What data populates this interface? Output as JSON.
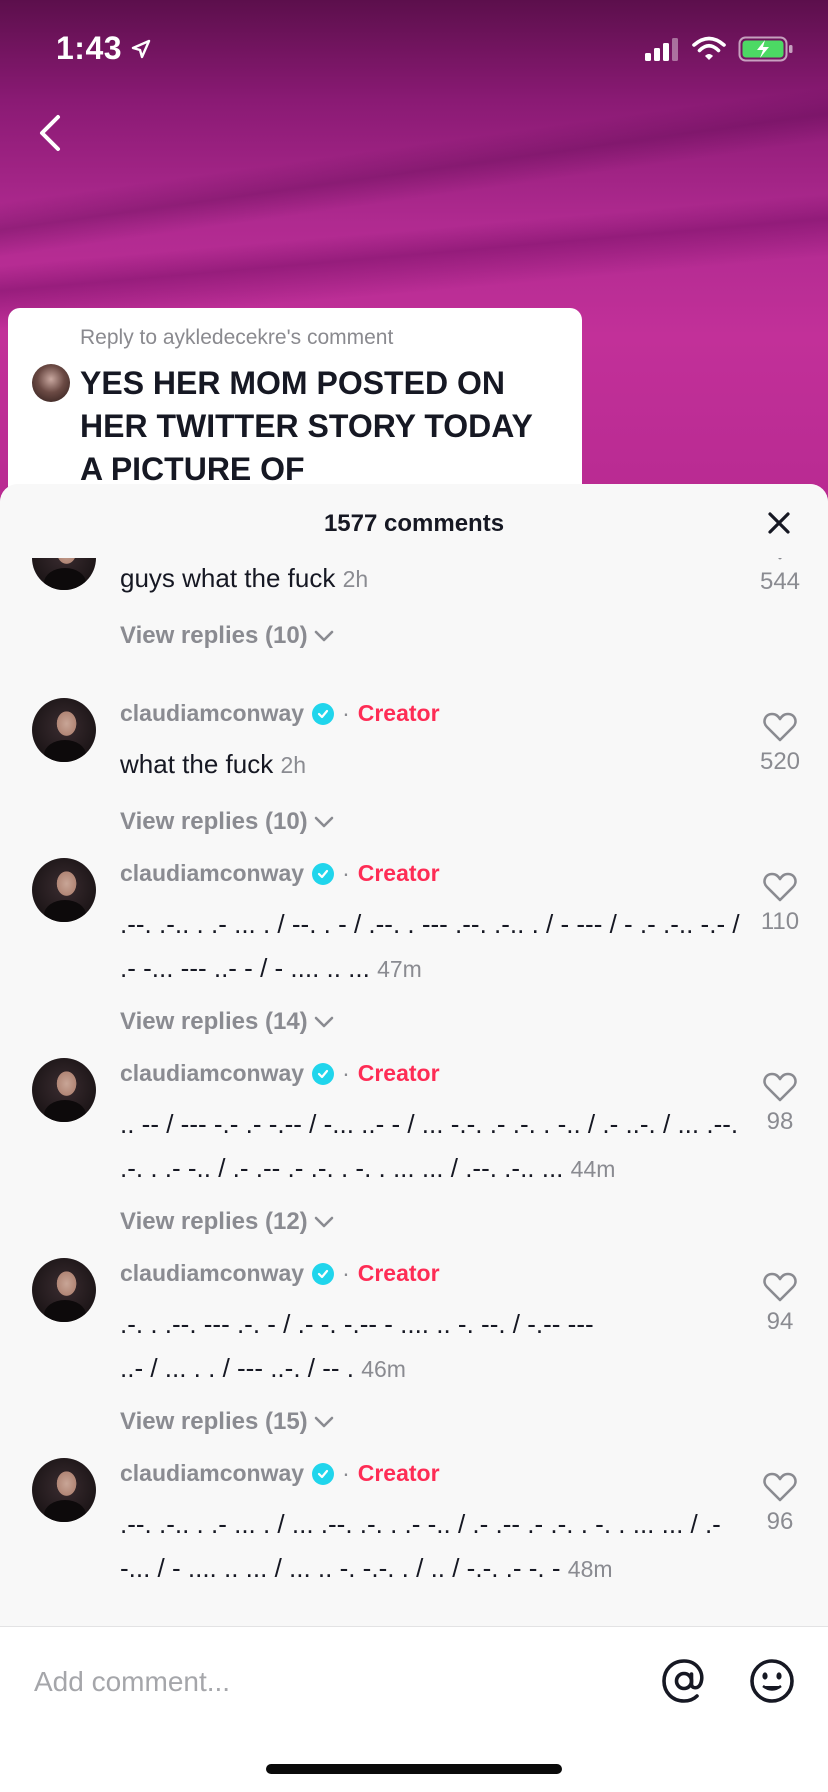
{
  "status_bar": {
    "time": "1:43"
  },
  "reply_card": {
    "label": "Reply to aykledecekre's comment",
    "text": "YES HER MOM POSTED ON HER TWITTER STORY TODAY A PICTURE OF"
  },
  "sheet": {
    "title": "1577 comments"
  },
  "comments": [
    {
      "username": "",
      "text": "guys what the fuck",
      "time": "2h",
      "replies": "View replies (10)",
      "likes": "544"
    },
    {
      "username": "claudiamconway",
      "badge": "Creator",
      "separator": "·",
      "text": "what the fuck",
      "time": "2h",
      "replies": "View replies (10)",
      "likes": "520"
    },
    {
      "username": "claudiamconway",
      "badge": "Creator",
      "separator": "·",
      "text": ".--. .-.. . .- ... . / --. . - / .--. . --- .--. .-.. . / - --- / - .- .-.. -.- / .- -... --- ..- - / - .... .. ...",
      "time": "47m",
      "replies": "View replies (14)",
      "likes": "110"
    },
    {
      "username": "claudiamconway",
      "badge": "Creator",
      "separator": "·",
      "text": ".. -- / --- -.- .- -.-- / -... ..- - / ... -.-. .- .-. . -.. / .- ..-. / ... .--. .-. . .- -.. / .- .-- .- .-. . -. . ... ... / .--. .-.. ...",
      "time": "44m",
      "replies": "View replies (12)",
      "likes": "98"
    },
    {
      "username": "claudiamconway",
      "badge": "Creator",
      "separator": "·",
      "text": ".-. . .--. --- .-. - / .- -. -.-- - .... .. -. --. / -.-- --- ..- / ... . . / --- ..-. / -- .",
      "time": "46m",
      "replies": "View replies (15)",
      "likes": "94"
    },
    {
      "username": "claudiamconway",
      "badge": "Creator",
      "separator": "·",
      "text": ".--. .-.. . .- ... . / ... .--. .-. . .- -.. / .- .-- .- .-. . -. . ... ... / .- -... / - .... .. ... / ... .. -. -.-. . / .. / -.-. .- -. -",
      "time": "48m",
      "replies": "",
      "likes": "96"
    }
  ],
  "input": {
    "placeholder": "Add comment..."
  },
  "icons": {
    "back": "chevron-left-icon",
    "close": "close-icon",
    "like": "heart-icon",
    "verified": "verified-check-icon",
    "mention": "at-sign-icon",
    "emoji": "smiley-face-icon"
  },
  "colors": {
    "creator": "#fe2c55",
    "verified": "#20d5ec",
    "muted": "#8a8b91",
    "text": "#161823"
  }
}
